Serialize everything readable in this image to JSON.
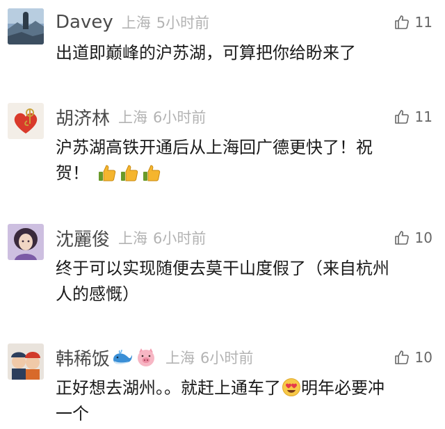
{
  "comments": [
    {
      "username": "Davey",
      "location": "上海",
      "time": "5小时前",
      "likes": "11",
      "text_lines": [
        "出道即巅峰的沪苏湖，可算把你给盼来了"
      ]
    },
    {
      "username": "胡济林",
      "location": "上海",
      "time": "6小时前",
      "likes": "11",
      "text_lines": [
        "沪苏湖高铁开通后从上海回广德更快了！祝",
        "贺！"
      ],
      "emoji": [
        "thumbs-up",
        "thumbs-up",
        "thumbs-up"
      ]
    },
    {
      "username": "沈麗俊",
      "location": "上海",
      "time": "6小时前",
      "likes": "10",
      "text_lines": [
        "终于可以实现随便去莫干山度假了（来自杭州",
        "人的感慨）"
      ]
    },
    {
      "username": "韩稀饭",
      "badges": [
        "whale-emoji",
        "pig-emoji"
      ],
      "location": "上海",
      "time": "6小时前",
      "likes": "10",
      "text_lines": [
        "正好想去湖州。。就赶上通车了",
        "明年必要冲",
        "一个"
      ],
      "emoji": [
        "heart-eyes-face"
      ]
    }
  ],
  "colors": {
    "username": "#4a4a4a",
    "meta": "#b3b3b3",
    "text": "#1a1a1a",
    "like": "#666666",
    "thumb_emoji": "#f5b52e"
  }
}
